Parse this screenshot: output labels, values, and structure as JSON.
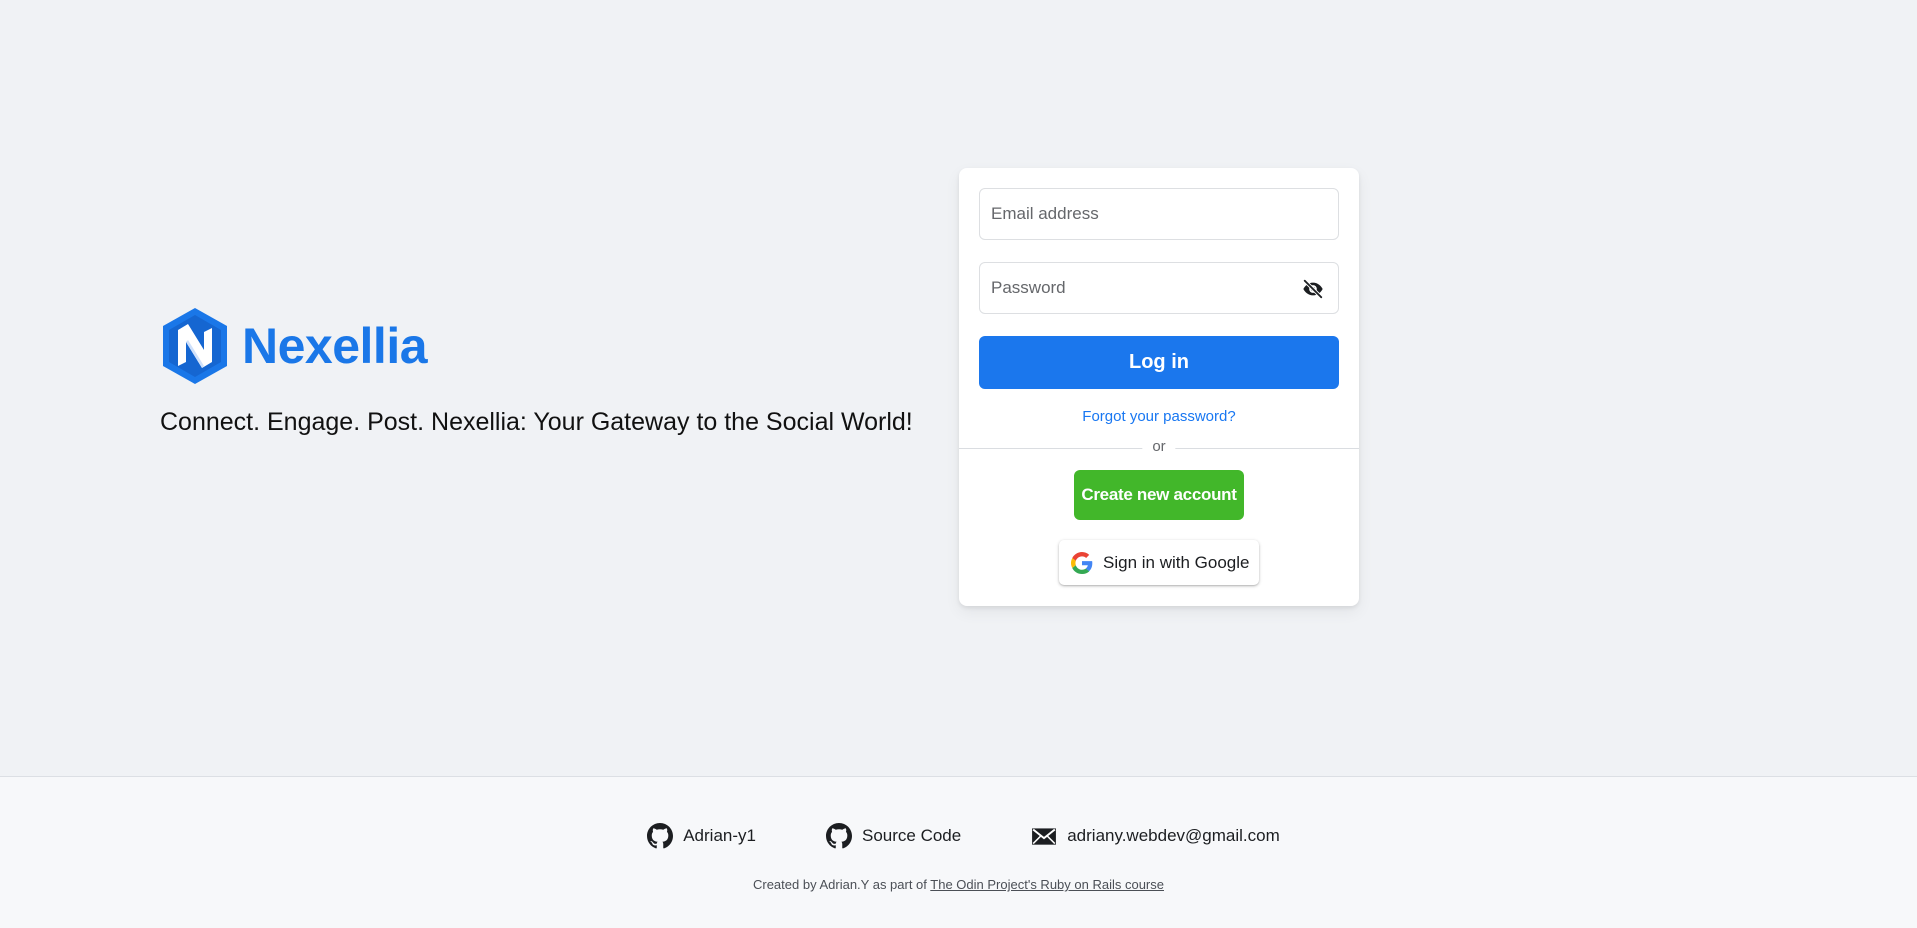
{
  "brand": {
    "name": "Nexellia",
    "tagline": "Connect. Engage. Post. Nexellia: Your Gateway to the Social World!",
    "accent_color": "#1a77e8",
    "logo_icon": "hexagon-n-logo-icon"
  },
  "login_form": {
    "email_placeholder": "Email address",
    "email_value": "",
    "password_placeholder": "Password",
    "password_value": "",
    "password_toggle_icon": "eye-slash-icon",
    "login_label": "Log in",
    "login_color": "#1b77ed",
    "forgot_label": "Forgot your password?",
    "divider_label": "or",
    "create_label": "Create new account",
    "create_color": "#42b72a",
    "google_label": "Sign in with Google",
    "google_icon": "google-g-icon"
  },
  "footer": {
    "links": [
      {
        "label": "Adrian-y1",
        "icon": "github-icon"
      },
      {
        "label": "Source Code",
        "icon": "github-icon"
      },
      {
        "label": "adriany.webdev@gmail.com",
        "icon": "mail-icon"
      }
    ],
    "credits_prefix": "Created by Adrian.Y as part of",
    "credits_link": "The Odin Project's Ruby on Rails course"
  }
}
